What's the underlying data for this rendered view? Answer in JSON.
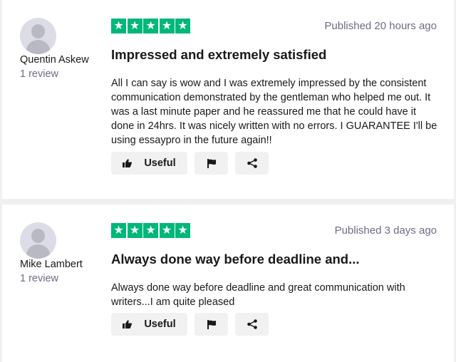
{
  "reviews": [
    {
      "author": "Quentin Askew",
      "review_count": "1 review",
      "rating": 5,
      "published": "Published 20 hours ago",
      "title": "Impressed and extremely satisfied",
      "text": "All I can say is wow and I was extremely impressed by the consistent communication demonstrated by the gentleman who helped me out. It was a last minute paper and he reassured me that he could have it done in 24hrs. It was nicely written with no errors. I GUARANTEE I'll be using essaypro in the future again!!",
      "useful_label": "Useful"
    },
    {
      "author": "Mike Lambert",
      "review_count": "1 review",
      "rating": 5,
      "published": "Published 3 days ago",
      "title": "Always done way before deadline and...",
      "text": "Always done way before deadline and great communication with writers...I am quite pleased",
      "useful_label": "Useful"
    }
  ],
  "icons": {
    "star": "star-icon",
    "useful": "thumbs-up-icon",
    "flag": "flag-icon",
    "share": "share-icon"
  },
  "colors": {
    "star_bg": "#00b67a",
    "muted_text": "#6c6c85",
    "button_bg": "#f1f1f1"
  }
}
